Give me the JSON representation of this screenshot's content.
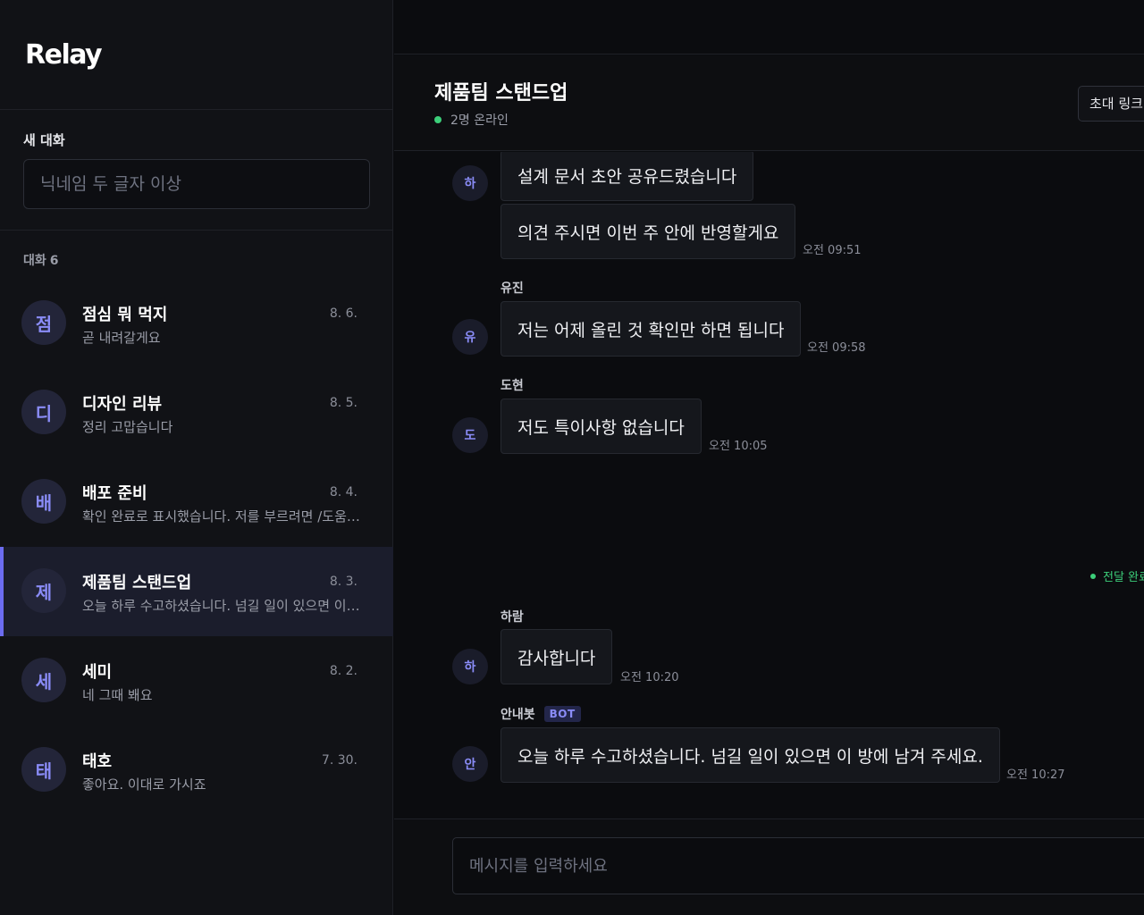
{
  "app": {
    "brand": "Relay"
  },
  "sidebar": {
    "new_chat_label": "새 대화",
    "nickname_placeholder": "닉네임 두 글자 이상",
    "conversations_label": "대화",
    "conversations_count": "6",
    "conversations": [
      {
        "avatar": "점",
        "name": "점심 뭐 먹지",
        "preview": "곧 내려갈게요",
        "date": "8. 6.",
        "active": false
      },
      {
        "avatar": "디",
        "name": "디자인 리뷰",
        "preview": "정리 고맙습니다",
        "date": "8. 5.",
        "active": false
      },
      {
        "avatar": "배",
        "name": "배포 준비",
        "preview": "확인 완료로 표시했습니다. 저를 부르려면 /도움말 을 입력하세요.",
        "date": "8. 4.",
        "active": false
      },
      {
        "avatar": "제",
        "name": "제품팀 스탠드업",
        "preview": "오늘 하루 수고하셨습니다. 넘길 일이 있으면 이 방에 남겨 주세요.",
        "date": "8. 3.",
        "active": true
      },
      {
        "avatar": "세",
        "name": "세미",
        "preview": "네 그때 봬요",
        "date": "8. 2.",
        "active": false
      },
      {
        "avatar": "태",
        "name": "태호",
        "preview": "좋아요. 이대로 가시죠",
        "date": "7. 30.",
        "active": false
      }
    ]
  },
  "header": {
    "title": "제품팀 스탠드업",
    "online": "2명 온라인",
    "invite_label": "초대 링크"
  },
  "messages": {
    "group1": {
      "avatar": "하",
      "bubble1": "설계 문서 초안 공유드렸습니다",
      "bubble2": "의견 주시면 이번 주 안에 반영할게요",
      "time": "오전 09:51"
    },
    "group2": {
      "sender": "유진",
      "avatar": "유",
      "text": "저는 어제 올린 것 확인만 하면 됩니다",
      "time": "오전 09:58"
    },
    "group3": {
      "sender": "도현",
      "avatar": "도",
      "text": "저도 특이사항 없습니다",
      "time": "오전 10:05"
    },
    "delivered": "전달 완료",
    "group4": {
      "sender": "하람",
      "avatar": "하",
      "text": "감사합니다",
      "time": "오전 10:20"
    },
    "group5": {
      "sender": "안내봇",
      "badge": "BOT",
      "avatar": "안",
      "text": "오늘 하루 수고하셨습니다. 넘길 일이 있으면 이 방에 남겨 주세요.",
      "time": "오전 10:27"
    }
  },
  "composer": {
    "placeholder": "메시지를 입력하세요"
  },
  "colors": {
    "accent": "#6c6cf0",
    "online": "#3ccf7a",
    "background": "#0b0c0f",
    "sidebar": "#111216"
  }
}
